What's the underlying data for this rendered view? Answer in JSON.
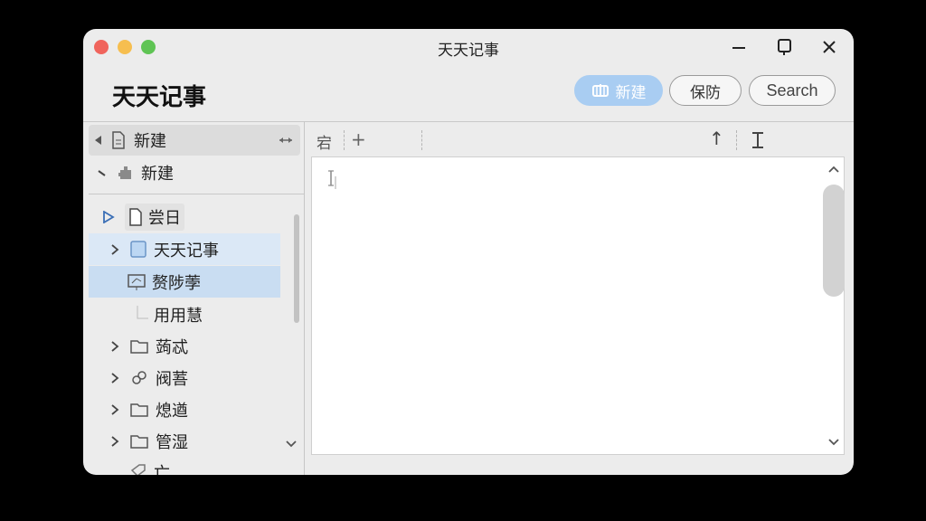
{
  "window": {
    "title": "天天记事"
  },
  "header": {
    "app_title": "天天记事",
    "buttons": {
      "new": "新建",
      "save": "保防",
      "search": "Search"
    }
  },
  "sidebar": {
    "quick": [
      {
        "label": "新建",
        "icon": "document-icon"
      },
      {
        "label": "新建",
        "icon": "puzzle-icon"
      }
    ],
    "tree": [
      {
        "label": "尝日𨹙",
        "icon": "document-icon"
      },
      {
        "label": "天天记事",
        "icon": "notebook-icon"
      },
      {
        "label": "赘陟荸",
        "icon": "monitor-icon"
      },
      {
        "label": "用用慧",
        "icon": ""
      },
      {
        "label": "蒟忒",
        "icon": "folder-icon"
      },
      {
        "label": "阀䓊",
        "icon": "link-icon"
      },
      {
        "label": "熄遒",
        "icon": "folder-icon"
      },
      {
        "label": "管湿",
        "icon": "folder-icon"
      },
      {
        "label": "亡",
        "icon": "tag-icon"
      }
    ]
  },
  "editor": {
    "toolbar": {
      "style_label": "宕",
      "add_label": "+",
      "up_label": "↑"
    },
    "content": ""
  }
}
